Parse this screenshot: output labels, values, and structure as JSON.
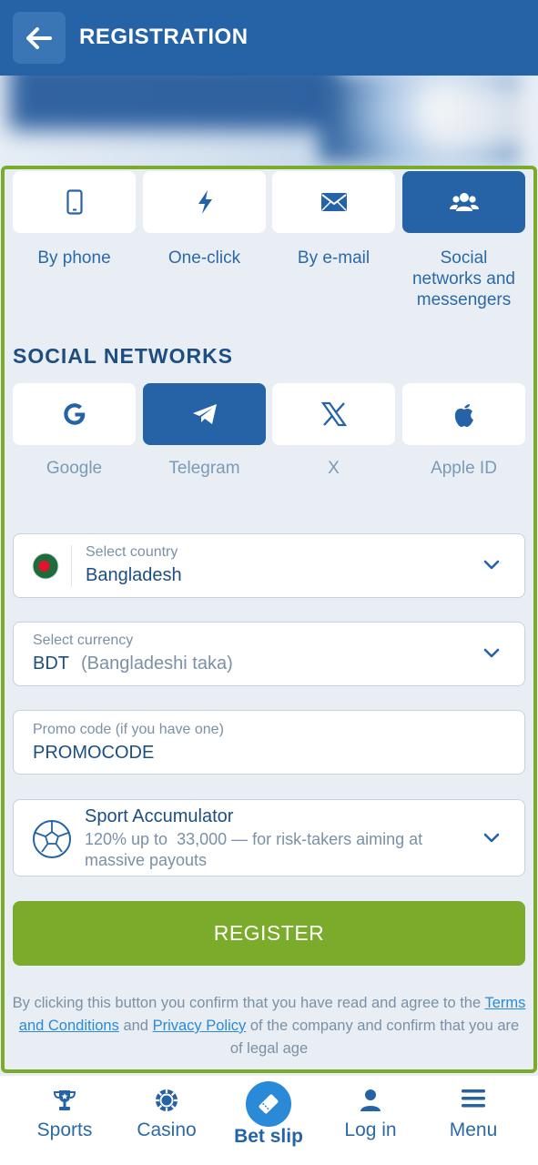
{
  "header": {
    "title": "REGISTRATION"
  },
  "methods": [
    {
      "label": "By phone",
      "icon": "phone-icon"
    },
    {
      "label": "One-click",
      "icon": "lightning-icon"
    },
    {
      "label": "By e-mail",
      "icon": "envelope-icon"
    },
    {
      "label": "Social networks and messengers",
      "label_lines": [
        "Social",
        "networks and",
        "messengers"
      ],
      "icon": "users-icon",
      "active": true
    }
  ],
  "social": {
    "title": "SOCIAL NETWORKS",
    "items": [
      {
        "label": "Google",
        "icon": "google-icon"
      },
      {
        "label": "Telegram",
        "icon": "telegram-icon",
        "active": true
      },
      {
        "label": "X",
        "icon": "x-icon"
      },
      {
        "label": "Apple ID",
        "icon": "apple-icon"
      }
    ]
  },
  "country": {
    "label": "Select country",
    "value": "Bangladesh"
  },
  "currency": {
    "label": "Select currency",
    "code": "BDT",
    "name": "(Bangladeshi taka)"
  },
  "promo": {
    "label": "Promo code (if you have one)",
    "value": "PROMOCODE"
  },
  "bonus": {
    "title": "Sport Accumulator",
    "line1": "120% up to  33,000 — for risk-takers aiming at",
    "line2": "massive payouts"
  },
  "register_label": "REGISTER",
  "legal": {
    "before": "By clicking this button you confirm that you have read and agree to the",
    "terms": "Terms and Conditions",
    "and": "and",
    "privacy": "Privacy Policy",
    "after": "of the company and confirm that you are of legal age"
  },
  "nav": [
    {
      "label": "Sports",
      "icon": "trophy-icon"
    },
    {
      "label": "Casino",
      "icon": "casino-chip-icon"
    },
    {
      "label": "Bet slip",
      "icon": "ticket-icon",
      "active": true
    },
    {
      "label": "Log in",
      "icon": "user-icon"
    },
    {
      "label": "Menu",
      "icon": "menu-icon"
    }
  ],
  "colors": {
    "primary": "#2563a6",
    "accent": "#7aab2b",
    "background": "#e8eef4"
  }
}
